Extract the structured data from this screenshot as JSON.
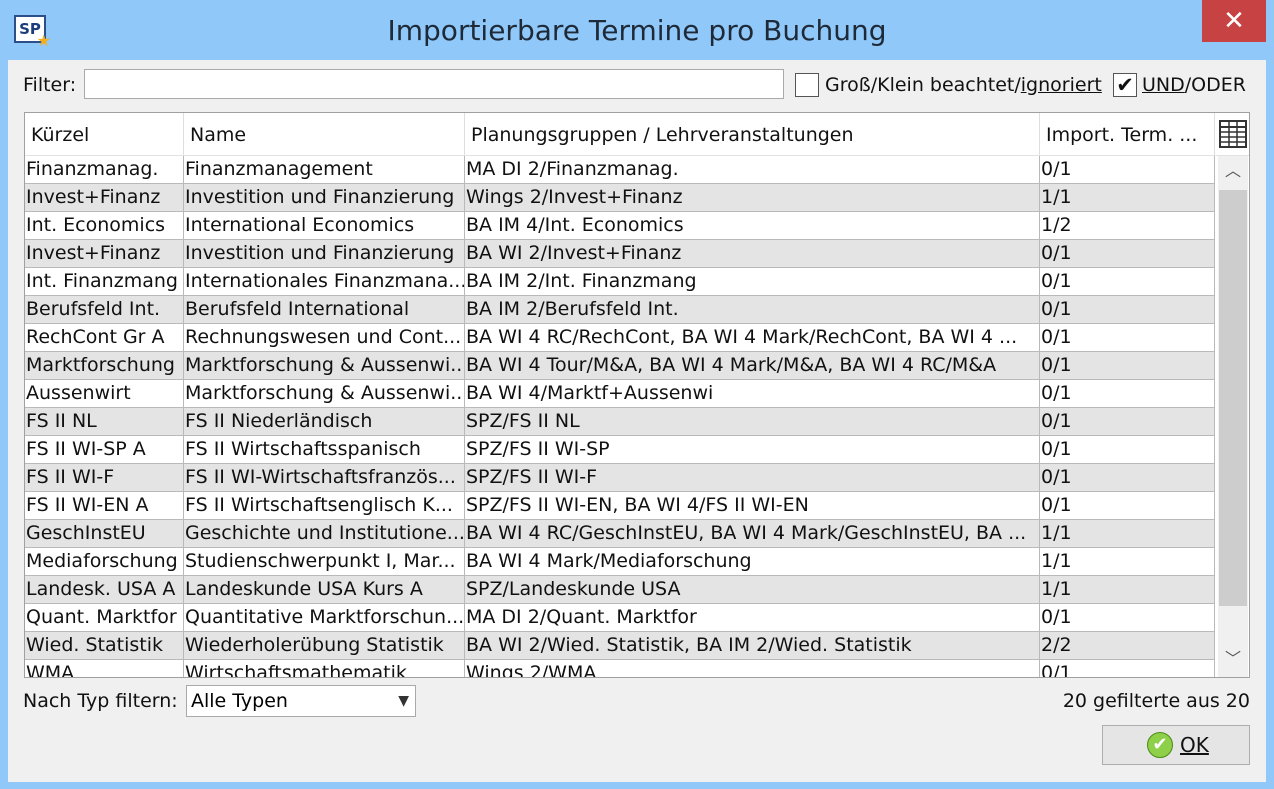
{
  "window": {
    "title": "Importierbare Termine pro Buchung",
    "app_icon": "SP",
    "close_glyph": "✕"
  },
  "filter": {
    "label": "Filter:",
    "value": ""
  },
  "case_option": {
    "checked": false,
    "prefix": "Groß/Klein beachtet/",
    "underlined": "ignoriert"
  },
  "logic_option": {
    "checked": true,
    "underlined": "UND",
    "suffix": "/ODER"
  },
  "table": {
    "columns": [
      "Kürzel",
      "Name",
      "Planungsgruppen / Lehrveranstaltungen",
      "Import. Term. ..."
    ],
    "rows": [
      [
        "Finanzmanag.",
        "Finanzmanagement",
        "MA DI 2/Finanzmanag.",
        "0/1"
      ],
      [
        "Invest+Finanz",
        "Investition und Finanzierung",
        "Wings 2/Invest+Finanz",
        "1/1"
      ],
      [
        "Int. Economics",
        "International Economics",
        "BA IM 4/Int. Economics",
        "1/2"
      ],
      [
        "Invest+Finanz",
        "Investition und Finanzierung",
        "BA WI 2/Invest+Finanz",
        "0/1"
      ],
      [
        "Int. Finanzmang",
        "Internationales Finanzmana...",
        "BA IM 2/Int. Finanzmang",
        "0/1"
      ],
      [
        "Berufsfeld Int.",
        "Berufsfeld International",
        "BA IM 2/Berufsfeld Int.",
        "0/1"
      ],
      [
        "RechCont Gr A",
        "Rechnungswesen und Cont...",
        "BA WI 4 RC/RechCont, BA WI 4 Mark/RechCont, BA WI 4 ...",
        "0/1"
      ],
      [
        "Marktforschung",
        "Marktforschung & Aussenwi...",
        "BA WI 4 Tour/M&A, BA WI 4 Mark/M&A, BA WI 4 RC/M&A",
        "0/1"
      ],
      [
        "Aussenwirt",
        "Marktforschung & Aussenwi...",
        "BA WI 4/Marktf+Aussenwi",
        "0/1"
      ],
      [
        "FS II NL",
        "FS II Niederländisch",
        "SPZ/FS II NL",
        "0/1"
      ],
      [
        "FS II WI-SP A",
        "FS II Wirtschaftsspanisch",
        "SPZ/FS II WI-SP",
        "0/1"
      ],
      [
        "FS II WI-F",
        "FS II WI-Wirtschaftsfranzös...",
        "SPZ/FS II WI-F",
        "0/1"
      ],
      [
        "FS II WI-EN A",
        "FS II Wirtschaftsenglisch K...",
        "SPZ/FS II WI-EN, BA WI 4/FS II WI-EN",
        "0/1"
      ],
      [
        "GeschInstEU",
        "Geschichte und Institutione...",
        "BA WI 4 RC/GeschInstEU, BA WI 4 Mark/GeschInstEU, BA ...",
        "1/1"
      ],
      [
        "Mediaforschung",
        "Studienschwerpunkt I, Mar...",
        "BA WI 4 Mark/Mediaforschung",
        "1/1"
      ],
      [
        "Landesk. USA A",
        "Landeskunde USA Kurs A",
        "SPZ/Landeskunde USA",
        "1/1"
      ],
      [
        "Quant. Marktfor",
        "Quantitative Marktforschun...",
        "MA DI 2/Quant. Marktfor",
        "0/1"
      ],
      [
        "Wied. Statistik",
        "Wiederholerübung Statistik",
        "BA WI 2/Wied. Statistik, BA IM 2/Wied. Statistik",
        "2/2"
      ],
      [
        "WMA",
        "Wirtschaftsmathematik",
        "Wings 2/WMA",
        "0/1"
      ]
    ]
  },
  "type_filter": {
    "label": "Nach Typ filtern:",
    "selected": "Alle Typen"
  },
  "count_text": "20 gefilterte aus 20",
  "ok_button": {
    "label": "OK"
  },
  "icons": {
    "scroll_up": "︿",
    "scroll_down": "﹀",
    "checkmark": "✔",
    "caret": "⌄"
  }
}
